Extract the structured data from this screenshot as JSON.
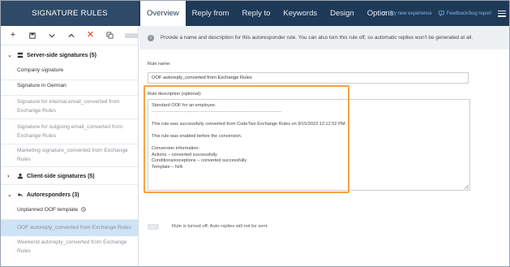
{
  "app": {
    "title": "SIGNATURE RULES"
  },
  "tabs": [
    {
      "label": "Overview",
      "active": true
    },
    {
      "label": "Reply from"
    },
    {
      "label": "Reply to"
    },
    {
      "label": "Keywords"
    },
    {
      "label": "Design"
    },
    {
      "label": "Options"
    }
  ],
  "top_links": {
    "try_new": "Try new experience",
    "feedback": "Feedback/bug report"
  },
  "sidebar": {
    "groups": [
      {
        "label": "Server-side signatures (5)",
        "expanded": true,
        "items": [
          {
            "label": "Company signature",
            "muted": false
          },
          {
            "label": "Signature in German",
            "muted": false
          },
          {
            "label": "Signature for internal email_converted from Exchange Rules",
            "muted": true
          },
          {
            "label": "Signature for outgoing email_converted from Exchange Rules",
            "muted": true
          },
          {
            "label": "Marketing signature_converted from Exchange Rules",
            "muted": true
          }
        ]
      },
      {
        "label": "Client-side signatures (5)",
        "expanded": false,
        "items": []
      },
      {
        "label": "Autoresponders (3)",
        "expanded": true,
        "items": [
          {
            "label": "Unplanned OOF template",
            "muted": false
          },
          {
            "label": "OOF autoreply_converted from Exchange Rules",
            "muted": true,
            "selected": true
          },
          {
            "label": "Weekend autoreply_converted from Exchange Rules",
            "muted": true
          }
        ]
      }
    ]
  },
  "main": {
    "info_text": "Provide a name and description for this autoresponder rule. You can also turn this rule off, so automatic replies won't be generated at all.",
    "rule_name_label": "Rule name:",
    "rule_name_value": "OOF autoreply_converted from Exchange Rules",
    "rule_desc_label": "Rule description (optional):",
    "rule_desc_lines": [
      "Standard OOF for an employee.",
      "--------------------------------------------------------------------------------------------------------",
      "",
      "This rule was successfully converted from CodeTwo Exchange Rules on 9/15/2022 12:12:52 PM.",
      "",
      "This rule was enabled before the conversion.",
      "",
      "Conversion information:",
      "Actions – converted successfully",
      "Conditions/exceptions – converted successfully",
      "Template – N/A"
    ],
    "switch_text": "OFF",
    "switch_label": "Rule is turned off. Auto replies will not be sent."
  },
  "colors": {
    "topbar": "#1f3a57",
    "accent_highlight": "#f5a342",
    "selected_row": "#cfe3f7",
    "delete_red": "#e0341c"
  }
}
